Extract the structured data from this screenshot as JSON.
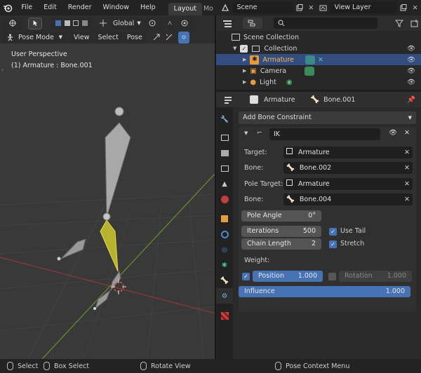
{
  "menu": {
    "items": [
      "File",
      "Edit",
      "Render",
      "Window",
      "Help"
    ]
  },
  "workspace": {
    "active_tab": "Layout",
    "next_tab": "Mo"
  },
  "scene": {
    "name": "Scene"
  },
  "view_layer": {
    "name": "View Layer"
  },
  "viewport": {
    "mode": "Pose Mode",
    "menus": [
      "View",
      "Select",
      "Pose"
    ],
    "transform_orientation": "Global",
    "perspective": "User Perspective",
    "active_object": "(1) Armature : Bone.001"
  },
  "outliner": {
    "root": "Scene Collection",
    "collection": "Collection",
    "items": [
      {
        "name": "Armature",
        "selected": true
      },
      {
        "name": "Camera",
        "selected": false
      },
      {
        "name": "Light",
        "selected": false
      }
    ]
  },
  "properties": {
    "breadcrumb_object": "Armature",
    "breadcrumb_bone": "Bone.001",
    "add_constraint_label": "Add Bone Constraint",
    "constraint": {
      "name": "IK",
      "target_label": "Target:",
      "target": "Armature",
      "bone_label": "Bone:",
      "bone": "Bone.002",
      "pole_target_label": "Pole Target:",
      "pole_target": "Armature",
      "pole_bone_label": "Bone:",
      "pole_bone": "Bone.004",
      "pole_angle_label": "Pole Angle",
      "pole_angle": "0°",
      "iterations_label": "Iterations",
      "iterations": "500",
      "use_tail_label": "Use Tail",
      "use_tail": true,
      "chain_length_label": "Chain Length",
      "chain_length": "2",
      "stretch_label": "Stretch",
      "stretch": true,
      "weight_label": "Weight:",
      "position_label": "Position",
      "position": "1.000",
      "position_enabled": true,
      "rotation_label": "Rotation",
      "rotation": "1.000",
      "rotation_enabled": false,
      "influence_label": "Influence",
      "influence": "1.000",
      "influence_fraction": 1.0
    }
  },
  "statusbar": {
    "select": "Select",
    "box_select": "Box Select",
    "rotate_view": "Rotate View",
    "context_menu": "Pose Context Menu"
  },
  "colors": {
    "accent": "#4772b3",
    "selected_row": "#334d80",
    "active_bone": "#b8b32e",
    "x_axis": "#8f3a3a",
    "y_axis": "#6a8f2a"
  }
}
